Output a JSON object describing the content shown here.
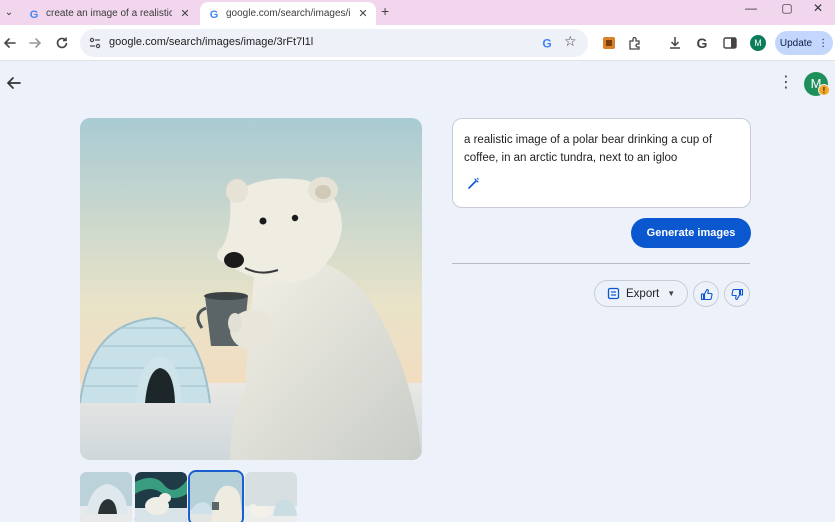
{
  "browser": {
    "tabs": [
      {
        "title": "create an image of a realistic b",
        "active": false
      },
      {
        "title": "google.com/search/images/ima",
        "active": true
      }
    ],
    "new_tab_symbol": "+",
    "window_controls": {
      "minimize": "—",
      "maximize": "▢",
      "close": "✕"
    },
    "url": "google.com/search/images/image/3rFt7l1l",
    "profile_initial": "M",
    "update_label": "Update",
    "colors": {
      "tabstrip": "#f1d6ee",
      "update_bg": "#c2d7fb"
    }
  },
  "page": {
    "avatar_initial": "M",
    "avatar_badge": "!",
    "prompt": "a realistic image of a polar bear drinking a cup of coffee, in an arctic tundra, next to an igloo",
    "generate_label": "Generate images",
    "export_label": "Export",
    "thumbnails": [
      "igloo",
      "bear-aurora",
      "bear-coffee",
      "bears-igloo"
    ],
    "selected_thumbnail": 2,
    "colors": {
      "accent": "#0b57d0",
      "page_bg": "#edf2fa"
    }
  }
}
